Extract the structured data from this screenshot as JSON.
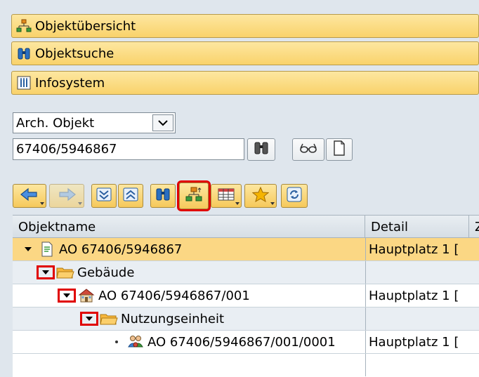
{
  "nav_panels": [
    {
      "label": "Objektübersicht",
      "icon": "hierarchy-icon"
    },
    {
      "label": "Objektsuche",
      "icon": "binoculars-icon"
    },
    {
      "label": "Infosystem",
      "icon": "infosystem-icon"
    }
  ],
  "search": {
    "object_type": "Arch. Objekt",
    "object_id": "67406/5946867"
  },
  "toolbar": {
    "icons": [
      "arrow-left-icon",
      "arrow-right-icon",
      "expand-all-icon",
      "collapse-all-icon",
      "find-icon",
      "hierarchy-icon",
      "layout-icon",
      "favorites-icon",
      "refresh-icon"
    ],
    "active": "hierarchy-icon"
  },
  "grid": {
    "columns": [
      "Objektname",
      "Detail",
      "Z"
    ],
    "rows": [
      {
        "name": "AO 67406/5946867",
        "detail": "Hauptplatz  1 [",
        "icon": "document-icon",
        "level": 0,
        "selected": true
      },
      {
        "name": "Gebäude",
        "detail": "",
        "icon": "folder-icon",
        "level": 1,
        "selected": false
      },
      {
        "name": "AO 67406/5946867/001",
        "detail": "Hauptplatz  1 [",
        "icon": "building-icon",
        "level": 2,
        "selected": false
      },
      {
        "name": "Nutzungseinheit",
        "detail": "",
        "icon": "folder-icon",
        "level": 3,
        "selected": false
      },
      {
        "name": "AO 67406/5946867/001/0001",
        "detail": "Hauptplatz  1 [",
        "icon": "people-icon",
        "level": 4,
        "selected": false
      }
    ]
  },
  "colors": {
    "accent": "#f9d26b",
    "selected_row": "#fbd784",
    "highlight": "#e00000"
  }
}
